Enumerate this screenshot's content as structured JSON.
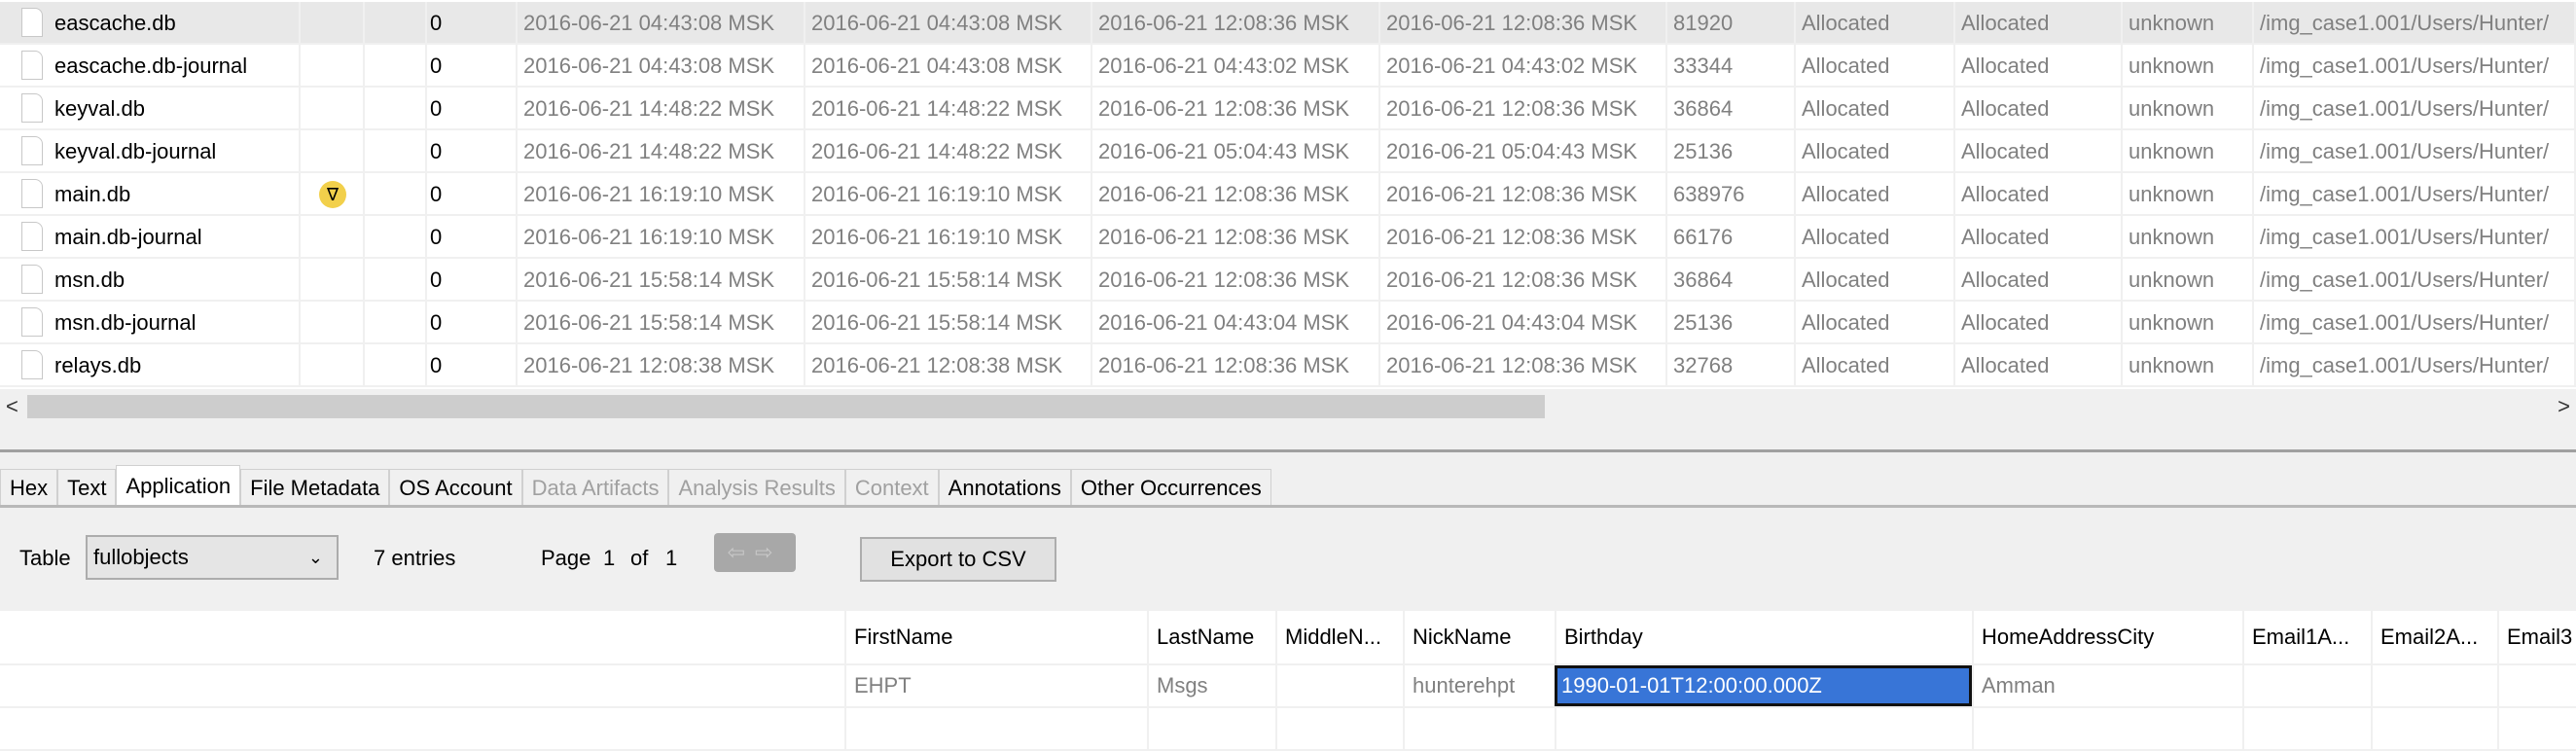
{
  "files": [
    {
      "name": "eascache.db",
      "flag": "",
      "count": "0",
      "t1": "2016-06-21 04:43:08 MSK",
      "t2": "2016-06-21 04:43:08 MSK",
      "t3": "2016-06-21 12:08:36 MSK",
      "t4": "2016-06-21 12:08:36 MSK",
      "size": "81920",
      "s1": "Allocated",
      "s2": "Allocated",
      "known": "unknown",
      "path": "/img_case1.001/Users/Hunter/"
    },
    {
      "name": "eascache.db-journal",
      "flag": "",
      "count": "0",
      "t1": "2016-06-21 04:43:08 MSK",
      "t2": "2016-06-21 04:43:08 MSK",
      "t3": "2016-06-21 04:43:02 MSK",
      "t4": "2016-06-21 04:43:02 MSK",
      "size": "33344",
      "s1": "Allocated",
      "s2": "Allocated",
      "known": "unknown",
      "path": "/img_case1.001/Users/Hunter/"
    },
    {
      "name": "keyval.db",
      "flag": "",
      "count": "0",
      "t1": "2016-06-21 14:48:22 MSK",
      "t2": "2016-06-21 14:48:22 MSK",
      "t3": "2016-06-21 12:08:36 MSK",
      "t4": "2016-06-21 12:08:36 MSK",
      "size": "36864",
      "s1": "Allocated",
      "s2": "Allocated",
      "known": "unknown",
      "path": "/img_case1.001/Users/Hunter/"
    },
    {
      "name": "keyval.db-journal",
      "flag": "",
      "count": "0",
      "t1": "2016-06-21 14:48:22 MSK",
      "t2": "2016-06-21 14:48:22 MSK",
      "t3": "2016-06-21 05:04:43 MSK",
      "t4": "2016-06-21 05:04:43 MSK",
      "size": "25136",
      "s1": "Allocated",
      "s2": "Allocated",
      "known": "unknown",
      "path": "/img_case1.001/Users/Hunter/"
    },
    {
      "name": "main.db",
      "flag": "∇",
      "count": "0",
      "t1": "2016-06-21 16:19:10 MSK",
      "t2": "2016-06-21 16:19:10 MSK",
      "t3": "2016-06-21 12:08:36 MSK",
      "t4": "2016-06-21 12:08:36 MSK",
      "size": "638976",
      "s1": "Allocated",
      "s2": "Allocated",
      "known": "unknown",
      "path": "/img_case1.001/Users/Hunter/"
    },
    {
      "name": "main.db-journal",
      "flag": "",
      "count": "0",
      "t1": "2016-06-21 16:19:10 MSK",
      "t2": "2016-06-21 16:19:10 MSK",
      "t3": "2016-06-21 12:08:36 MSK",
      "t4": "2016-06-21 12:08:36 MSK",
      "size": "66176",
      "s1": "Allocated",
      "s2": "Allocated",
      "known": "unknown",
      "path": "/img_case1.001/Users/Hunter/"
    },
    {
      "name": "msn.db",
      "flag": "",
      "count": "0",
      "t1": "2016-06-21 15:58:14 MSK",
      "t2": "2016-06-21 15:58:14 MSK",
      "t3": "2016-06-21 12:08:36 MSK",
      "t4": "2016-06-21 12:08:36 MSK",
      "size": "36864",
      "s1": "Allocated",
      "s2": "Allocated",
      "known": "unknown",
      "path": "/img_case1.001/Users/Hunter/"
    },
    {
      "name": "msn.db-journal",
      "flag": "",
      "count": "0",
      "t1": "2016-06-21 15:58:14 MSK",
      "t2": "2016-06-21 15:58:14 MSK",
      "t3": "2016-06-21 04:43:04 MSK",
      "t4": "2016-06-21 04:43:04 MSK",
      "size": "25136",
      "s1": "Allocated",
      "s2": "Allocated",
      "known": "unknown",
      "path": "/img_case1.001/Users/Hunter/"
    },
    {
      "name": "relays.db",
      "flag": "",
      "count": "0",
      "t1": "2016-06-21 12:08:38 MSK",
      "t2": "2016-06-21 12:08:38 MSK",
      "t3": "2016-06-21 12:08:36 MSK",
      "t4": "2016-06-21 12:08:36 MSK",
      "size": "32768",
      "s1": "Allocated",
      "s2": "Allocated",
      "known": "unknown",
      "path": "/img_case1.001/Users/Hunter/"
    }
  ],
  "scroll": {
    "left": "<",
    "right": ">"
  },
  "tabs": [
    {
      "label": "Hex",
      "state": "normal"
    },
    {
      "label": "Text",
      "state": "normal"
    },
    {
      "label": "Application",
      "state": "active"
    },
    {
      "label": "File Metadata",
      "state": "normal"
    },
    {
      "label": "OS Account",
      "state": "normal"
    },
    {
      "label": "Data Artifacts",
      "state": "disabled"
    },
    {
      "label": "Analysis Results",
      "state": "disabled"
    },
    {
      "label": "Context",
      "state": "disabled"
    },
    {
      "label": "Annotations",
      "state": "normal"
    },
    {
      "label": "Other Occurrences",
      "state": "normal"
    }
  ],
  "toolbar": {
    "table_label": "Table",
    "table_value": "fullobjects",
    "entries": "7 entries",
    "page_label": "Page",
    "page": "1",
    "of_label": "of",
    "pages": "1",
    "nav": "⇦⇨",
    "export": "Export to CSV"
  },
  "sqlite": {
    "columns": [
      "FirstName",
      "LastName",
      "MiddleN...",
      "NickName",
      "Birthday",
      "HomeAddressCity",
      "Email1A...",
      "Email2A...",
      "Email3"
    ],
    "rows": [
      [
        "EHPT",
        "Msgs",
        "",
        "hunterehpt",
        "1990-01-01T12:00:00.000Z",
        "Amman",
        "",
        "",
        ""
      ],
      [
        "",
        "",
        "",
        "",
        "",
        "",
        "",
        "",
        ""
      ]
    ]
  }
}
